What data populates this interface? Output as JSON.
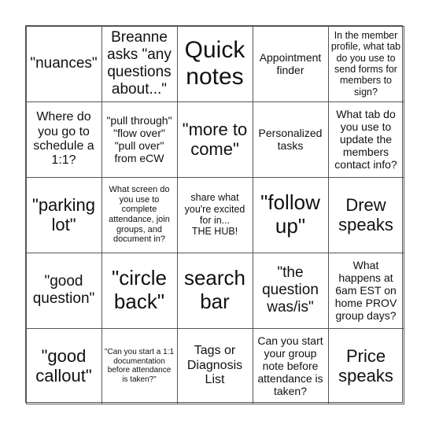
{
  "board": {
    "cells": [
      {
        "text": "\"nuances\""
      },
      {
        "text": "Breanne asks \"any questions about...\""
      },
      {
        "text": "Quick notes"
      },
      {
        "text": "Appointment finder"
      },
      {
        "text": "In the member profile, what tab do you use to send forms for members to sign?"
      },
      {
        "text": "Where do you go to schedule a 1:1?"
      },
      {
        "text": "\"pull through\"\n\"flow over\"\n\"pull over\" from eCW"
      },
      {
        "text": "\"more to come\""
      },
      {
        "text": "Personalized tasks"
      },
      {
        "text": "What tab do you use to update the members contact info?"
      },
      {
        "text": "\"parking lot\""
      },
      {
        "text": "What screen do you use to complete attendance, join groups, and document in?"
      },
      {
        "text": "share what you're excited for in...\nTHE HUB!"
      },
      {
        "text": "\"follow up\""
      },
      {
        "text": "Drew speaks"
      },
      {
        "text": "\"good question\""
      },
      {
        "text": "\"circle back\""
      },
      {
        "text": "search bar"
      },
      {
        "text": "\"the question was/is\""
      },
      {
        "text": "What happens at 6am EST on home PROV group days?"
      },
      {
        "text": "\"good callout\""
      },
      {
        "text": "\"Can you start a 1:1 documentation before attendance is taken?\""
      },
      {
        "text": "Tags or Diagnosis List"
      },
      {
        "text": "Can you start your group note before attendance is taken?"
      },
      {
        "text": "Price speaks"
      }
    ]
  }
}
